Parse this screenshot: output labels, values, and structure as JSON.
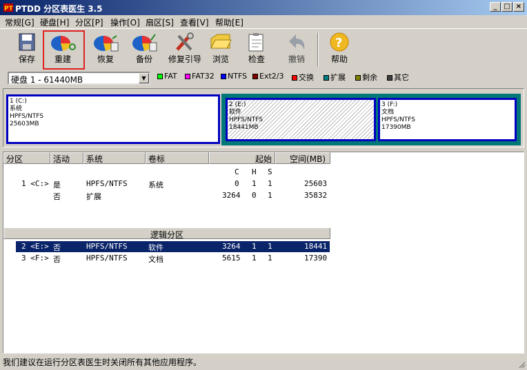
{
  "window": {
    "title": "PTDD 分区表医生 3.5",
    "min": "_",
    "max": "□",
    "close": "×"
  },
  "menu": [
    "常规[G]",
    "硬盘[H]",
    "分区[P]",
    "操作[O]",
    "扇区[S]",
    "查看[V]",
    "帮助[E]"
  ],
  "toolbar": {
    "save": "保存",
    "rebuild": "重建",
    "restore": "恢复",
    "backup": "备份",
    "repair_boot": "修复引导",
    "browse": "浏览",
    "check": "检查",
    "undo": "撤销",
    "help": "帮助"
  },
  "disk_select": {
    "value": "硬盘 1 - 61440MB"
  },
  "legend": [
    {
      "label": "FAT",
      "color": "#00ff00"
    },
    {
      "label": "FAT32",
      "color": "#ff00ff"
    },
    {
      "label": "NTFS",
      "color": "#0000ff"
    },
    {
      "label": "Ext2/3",
      "color": "#800000"
    },
    {
      "label": "交换",
      "color": "#ff0000"
    },
    {
      "label": "扩展",
      "color": "#008080"
    },
    {
      "label": "剩余",
      "color": "#808000"
    },
    {
      "label": "其它",
      "color": "#404040"
    }
  ],
  "map": {
    "p1": {
      "l1": "1 (C:)",
      "l2": "系统",
      "l3": "HPFS/NTFS",
      "l4": "25603MB"
    },
    "p2": {
      "l1": "2 (E:)",
      "l2": "软件",
      "l3": "HPFS/NTFS",
      "l4": "18441MB"
    },
    "p3": {
      "l1": "3 (F:)",
      "l2": "文档",
      "l3": "HPFS/NTFS",
      "l4": "17390MB"
    }
  },
  "table": {
    "headers": {
      "partition": "分区",
      "active": "活动",
      "system": "系统",
      "label": "卷标",
      "start": "起始",
      "size": "空间(MB)"
    },
    "chs": {
      "c": "C",
      "h": "H",
      "s": "S"
    },
    "logical_title": "逻辑分区",
    "primary": [
      {
        "part": "1 <C:>",
        "active": "是",
        "system": "HPFS/NTFS",
        "label": "系统",
        "c": "0",
        "h": "1",
        "s": "1",
        "size": "25603"
      },
      {
        "part": "",
        "active": "否",
        "system": "扩展",
        "label": "",
        "c": "3264",
        "h": "0",
        "s": "1",
        "size": "35832"
      }
    ],
    "logical": [
      {
        "part": "2 <E:>",
        "active": "否",
        "system": "HPFS/NTFS",
        "label": "软件",
        "c": "3264",
        "h": "1",
        "s": "1",
        "size": "18441"
      },
      {
        "part": "3 <F:>",
        "active": "否",
        "system": "HPFS/NTFS",
        "label": "文档",
        "c": "5615",
        "h": "1",
        "s": "1",
        "size": "17390"
      }
    ]
  },
  "status": "我们建议在运行分区表医生时关闭所有其他应用程序。"
}
